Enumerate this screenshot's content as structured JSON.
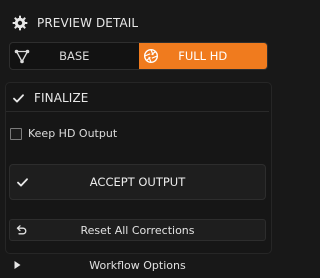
{
  "preview": {
    "header_label": "PREVIEW DETAIL",
    "header_icon": "gear-icon",
    "options": [
      {
        "label": "BASE",
        "icon": "triangle-nodes-icon",
        "active": false
      },
      {
        "label": "FULL HD",
        "icon": "aperture-icon",
        "active": true
      }
    ]
  },
  "finalize": {
    "header_label": "FINALIZE",
    "header_icon": "checkmark-icon",
    "keep_hd_output": {
      "label": "Keep HD Output",
      "checked": false
    },
    "accept_button": {
      "label": "ACCEPT OUTPUT",
      "icon": "checkmark-icon"
    },
    "reset_button": {
      "label": "Reset All Corrections",
      "icon": "undo-icon"
    }
  },
  "workflow": {
    "label": "Workflow Options",
    "icon": "play-triangle-icon",
    "expanded": false
  },
  "colors": {
    "accent": "#f07b1e",
    "background": "#181818",
    "text": "#e6e6e6"
  }
}
